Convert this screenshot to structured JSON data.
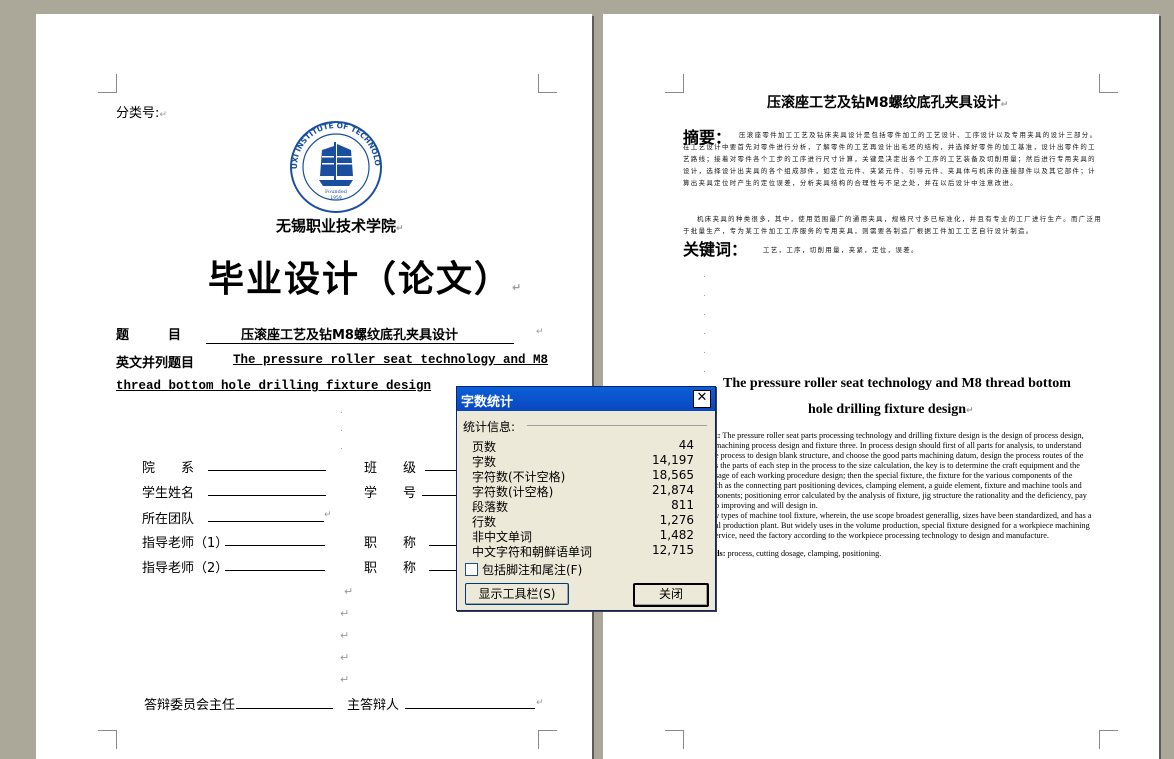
{
  "page1": {
    "classification_label": "分类号:",
    "school_name": "无锡职业技术学院",
    "logo": {
      "ring_text": "WUXI INSTITUTE OF TECHNOLOGY",
      "founded": "Founded",
      "year": "1959",
      "icon": "sailing-ship-emblem-icon",
      "color": "#1a4fa0"
    },
    "main_title": "毕业设计（论文）",
    "topic_label": "题　　　目",
    "topic_value": "压滚座工艺及钻M8螺纹底孔夹具设计",
    "en_title_label": "英文并列题目",
    "en_title_line1": "The pressure roller seat technology and M8",
    "en_title_line2": "thread bottom hole drilling fixture design",
    "fields": [
      {
        "label": "院　　系"
      },
      {
        "label": "班　　级"
      },
      {
        "label": "学生姓名"
      },
      {
        "label": "学　　号"
      },
      {
        "label": "所在团队"
      },
      {
        "label": "职　　称"
      },
      {
        "label": "职　　称"
      },
      {
        "label": "指导老师（1）"
      },
      {
        "label": "指导老师（2）"
      }
    ],
    "committee_label": "答辩委员会主任",
    "chief_label": "主答辩人"
  },
  "page2": {
    "title": "压滚座工艺及钻M8螺纹底孔夹具设计",
    "abstract_label": "摘要：",
    "abstract_text": "压滚座零件加工工艺及钻床夹具设计是包括零件加工的工艺设计、工序设计以及专用夹具的设计三部分。在工艺设计中要首先对零件进行分析，了解零件的工艺再设计出毛坯的结构，并选择好零件的加工基准，设计出零件的工艺路线；接着对零件各个工步的工序进行尺寸计算，关键是决定出各个工序的工艺装备及切削用量；然后进行专用夹具的设计，选择设计出夹具的各个组成部件，如定位元件、夹紧元件、引导元件、夹具体与机床的连接部件以及其它部件；计算出夹具定位时产生的定位误差，分析夹具结构的合理性与不足之处，并在以后设计中注意改进。",
    "abstract_text2": "机床夹具的种类很多，其中，使用范围最广的通用夹具，规格尺寸多已标准化，并且有专业的工厂进行生产。而广泛用于批量生产，专为某工件加工工序服务的专用夹具，则需要各制造厂根据工件加工工艺自行设计制造。",
    "keywords_label": "关键词：",
    "keywords_text": "工艺，工序，切削用量，夹紧，定位，误差。",
    "en_title_line1": "The pressure roller seat technology and M8 thread bottom",
    "en_title_line2": "hole drilling fixture design",
    "en_abstract_prefix": "t:",
    "en_abstract": [
      "The pressure roller seat parts processing technology and drilling fixture design is the design of process design,",
      "machining process design and fixture three. In process design should first of all parts for analysis, to understand",
      "e process to design blank structure, and choose the good parts machining datum, design the process routes of the",
      "s the parts of each step in the process to the size calculation, the key is to determine the craft equipment and the",
      "sage of each working procedure design; then the special fixture, the fixture for the various components of the",
      "ch as the connecting part positioning devices, clamping element, a guide element, fixture and machine tools and",
      "ponents; positioning error calculated by the analysis of fixture, jig structure the rationality and the deficiency, pay",
      "o improving and will design in.",
      "y types of machine tool fixture, wherein, the use scope broadest generallig, sizes have been standardized, and has a",
      "al production plant. But widely uses in the volume production, special fixture designed for a workpiece machining",
      "ervice, need the factory according to the workpiece processing technology to design and manufacture."
    ],
    "en_keywords_prefix": "ds:",
    "en_keywords": "process, cutting dosage, clamping, positioning."
  },
  "dialog": {
    "title": "字数统计",
    "section_label": "统计信息:",
    "stats": [
      {
        "label": "页数",
        "value": "44"
      },
      {
        "label": "字数",
        "value": "14,197"
      },
      {
        "label": "字符数(不计空格)",
        "value": "18,565"
      },
      {
        "label": "字符数(计空格)",
        "value": "21,874"
      },
      {
        "label": "段落数",
        "value": "811"
      },
      {
        "label": "行数",
        "value": "1,276"
      },
      {
        "label": "非中文单词",
        "value": "1,482"
      },
      {
        "label": "中文字符和朝鲜语单词",
        "value": "12,715"
      }
    ],
    "checkbox_label": "包括脚注和尾注(F)",
    "checkbox_checked": false,
    "toolbar_button": "显示工具栏(S)",
    "close_button": "关闭"
  },
  "paragraph_mark": "↵"
}
